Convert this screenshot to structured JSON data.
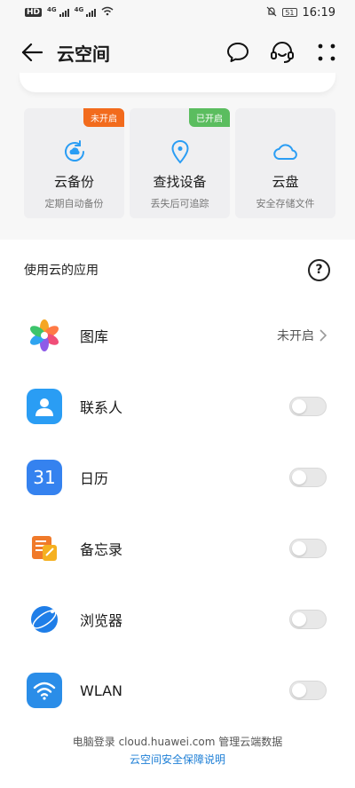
{
  "status_bar": {
    "hd": "HD",
    "net1": "4G",
    "net2": "4G",
    "battery": "51",
    "time": "16:19"
  },
  "header": {
    "title": "云空间",
    "icons": [
      "back-arrow-icon",
      "message-icon",
      "headset-icon",
      "more-icon"
    ]
  },
  "features": [
    {
      "name": "云备份",
      "desc": "定期自动备份",
      "badge": "未开启",
      "badge_color": "#f26b1d",
      "icon": "cloud-backup-icon"
    },
    {
      "name": "查找设备",
      "desc": "丢失后可追踪",
      "badge": "已开启",
      "badge_color": "#5bbd5f",
      "icon": "location-pin-icon"
    },
    {
      "name": "云盘",
      "desc": "安全存储文件",
      "badge": "",
      "icon": "cloud-icon"
    }
  ],
  "apps_section": {
    "title": "使用云的应用",
    "items": [
      {
        "name": "图库",
        "status": "未开启"
      },
      {
        "name": "联系人"
      },
      {
        "name": "日历",
        "icon_text": "31"
      },
      {
        "name": "备忘录"
      },
      {
        "name": "浏览器"
      },
      {
        "name": "WLAN"
      }
    ]
  },
  "footer": {
    "text": "电脑登录 cloud.huawei.com 管理云端数据",
    "link": "云空间安全保障说明"
  },
  "colors": {
    "accent": "#2a9df4",
    "badge_off": "#f26b1d",
    "badge_on": "#5bbd5f",
    "link": "#1e7fd6"
  }
}
